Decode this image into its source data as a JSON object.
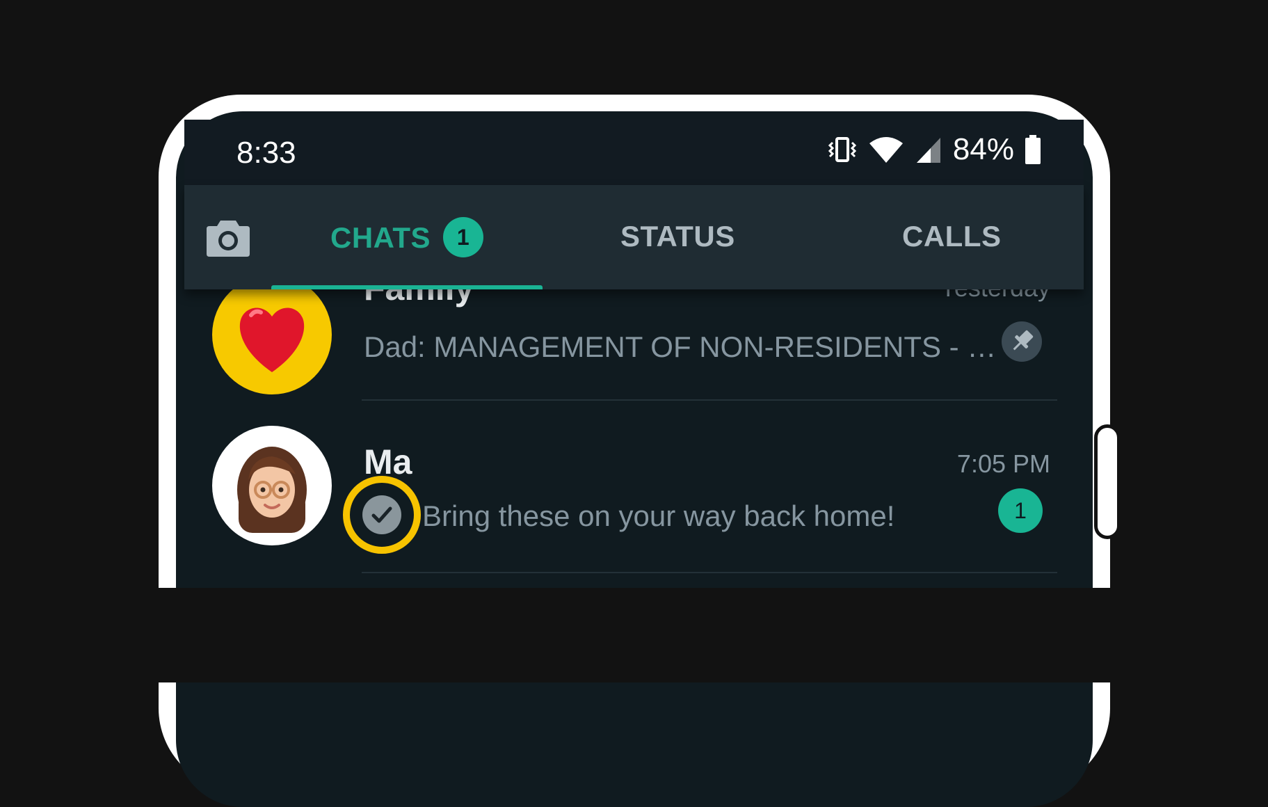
{
  "status_bar": {
    "time": "8:33",
    "battery": "84%",
    "icons": [
      "vibrate-icon",
      "wifi-icon",
      "signal-icon",
      "battery-icon"
    ]
  },
  "tabs": {
    "camera_icon": "camera-icon",
    "items": [
      {
        "label": "CHATS",
        "badge": "1",
        "active": true
      },
      {
        "label": "STATUS",
        "active": false
      },
      {
        "label": "CALLS",
        "active": false
      }
    ]
  },
  "chats": [
    {
      "name": "Family",
      "time": "Yesterday",
      "message": "Dad: MANAGEMENT OF NON-RESIDENTS - …",
      "avatar": "red-heart-emoji",
      "pinned": true
    },
    {
      "name": "Ma",
      "time": "7:05 PM",
      "message": "Bring these on your way back home!",
      "avatar": "memoji-woman-glasses",
      "unread": "1",
      "status_icon": "single-check-icon",
      "highlighted": true
    }
  ],
  "colors": {
    "accent": "#1ab394",
    "background": "#101b20",
    "appbar": "#1f2c33",
    "highlight": "#f7c300"
  }
}
